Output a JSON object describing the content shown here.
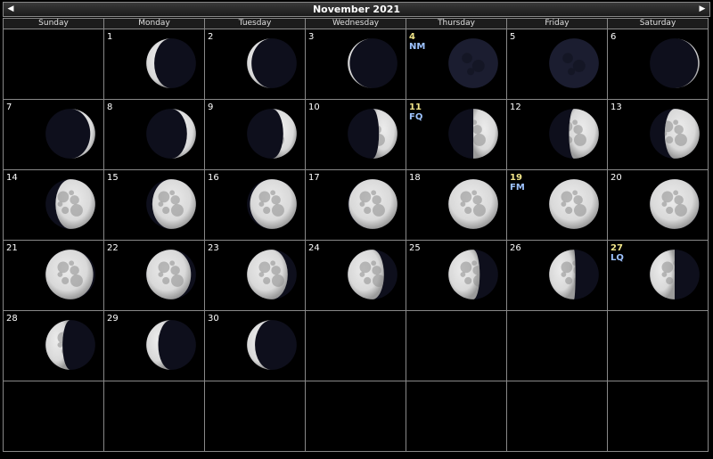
{
  "calendar": {
    "title": "November 2021",
    "prev_icon": "◀",
    "next_icon": "▶",
    "weekdays": [
      "Sunday",
      "Monday",
      "Tuesday",
      "Wednesday",
      "Thursday",
      "Friday",
      "Saturday"
    ],
    "first_weekday_index": 1,
    "days": [
      {
        "day": "1",
        "illumination": 0.16,
        "waxing": false
      },
      {
        "day": "2",
        "illumination": 0.09,
        "waxing": false
      },
      {
        "day": "3",
        "illumination": 0.04,
        "waxing": false
      },
      {
        "day": "4",
        "illumination": 0.0,
        "waxing": true,
        "phase": "NM"
      },
      {
        "day": "5",
        "illumination": 0.0,
        "waxing": true
      },
      {
        "day": "6",
        "illumination": 0.03,
        "waxing": true
      },
      {
        "day": "7",
        "illumination": 0.1,
        "waxing": true
      },
      {
        "day": "8",
        "illumination": 0.18,
        "waxing": true
      },
      {
        "day": "9",
        "illumination": 0.27,
        "waxing": true
      },
      {
        "day": "10",
        "illumination": 0.37,
        "waxing": true
      },
      {
        "day": "11",
        "illumination": 0.5,
        "waxing": true,
        "phase": "FQ"
      },
      {
        "day": "12",
        "illumination": 0.6,
        "waxing": true
      },
      {
        "day": "13",
        "illumination": 0.7,
        "waxing": true
      },
      {
        "day": "14",
        "illumination": 0.8,
        "waxing": true
      },
      {
        "day": "15",
        "illumination": 0.88,
        "waxing": true
      },
      {
        "day": "16",
        "illumination": 0.94,
        "waxing": true
      },
      {
        "day": "17",
        "illumination": 0.98,
        "waxing": true
      },
      {
        "day": "18",
        "illumination": 1.0,
        "waxing": true
      },
      {
        "day": "19",
        "illumination": 1.0,
        "waxing": false,
        "phase": "FM"
      },
      {
        "day": "20",
        "illumination": 0.99,
        "waxing": false
      },
      {
        "day": "21",
        "illumination": 0.96,
        "waxing": false
      },
      {
        "day": "22",
        "illumination": 0.9,
        "waxing": false
      },
      {
        "day": "23",
        "illumination": 0.82,
        "waxing": false
      },
      {
        "day": "24",
        "illumination": 0.73,
        "waxing": false
      },
      {
        "day": "25",
        "illumination": 0.63,
        "waxing": false
      },
      {
        "day": "26",
        "illumination": 0.53,
        "waxing": false
      },
      {
        "day": "27",
        "illumination": 0.5,
        "waxing": false,
        "phase": "LQ"
      },
      {
        "day": "28",
        "illumination": 0.34,
        "waxing": false
      },
      {
        "day": "29",
        "illumination": 0.24,
        "waxing": false
      },
      {
        "day": "30",
        "illumination": 0.16,
        "waxing": false
      }
    ],
    "total_cells": 42
  },
  "colors": {
    "background": "#000000",
    "grid": "#888888",
    "day_number": "#ffffff",
    "phase_day_number": "#f2e68a",
    "phase_label": "#9ec3ff",
    "moon_lit": "#d9d9d9",
    "moon_dark": "#0e0f1c"
  }
}
